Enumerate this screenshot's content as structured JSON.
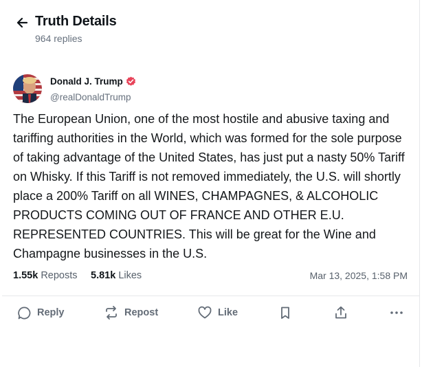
{
  "header": {
    "title": "Truth Details",
    "replies": "964 replies"
  },
  "post": {
    "author_name": "Donald J. Trump",
    "author_handle": "@realDonaldTrump",
    "text": "The European Union, one of the most hostile and abusive taxing and tariffing authorities in the World, which was formed for the sole purpose of taking advantage of the United States, has just put a nasty 50% Tariff on Whisky. If this Tariff is not removed immediately, the U.S. will shortly place a 200% Tariff on all WINES, CHAMPAGNES, & ALCOHOLIC PRODUCTS COMING OUT OF FRANCE AND OTHER E.U. REPRESENTED COUNTRIES. This will be great for the Wine and Champagne businesses in the U.S.",
    "reposts_count": "1.55k",
    "reposts_label": "Reposts",
    "likes_count": "5.81k",
    "likes_label": "Likes",
    "timestamp": "Mar 13, 2025, 1:58 PM"
  },
  "actions": {
    "reply_label": "Reply",
    "repost_label": "Repost",
    "like_label": "Like"
  },
  "icons": {
    "back": "arrow-left-icon",
    "verified": "verified-badge-icon",
    "reply": "speech-bubble-icon",
    "repost": "repost-arrows-icon",
    "like": "heart-icon",
    "bookmark": "bookmark-icon",
    "share": "share-upload-icon",
    "more": "more-dots-icon"
  },
  "colors": {
    "verified": "#e8445a",
    "text": "#0f1419",
    "muted": "#66707d",
    "divider": "#e6e7ea"
  }
}
